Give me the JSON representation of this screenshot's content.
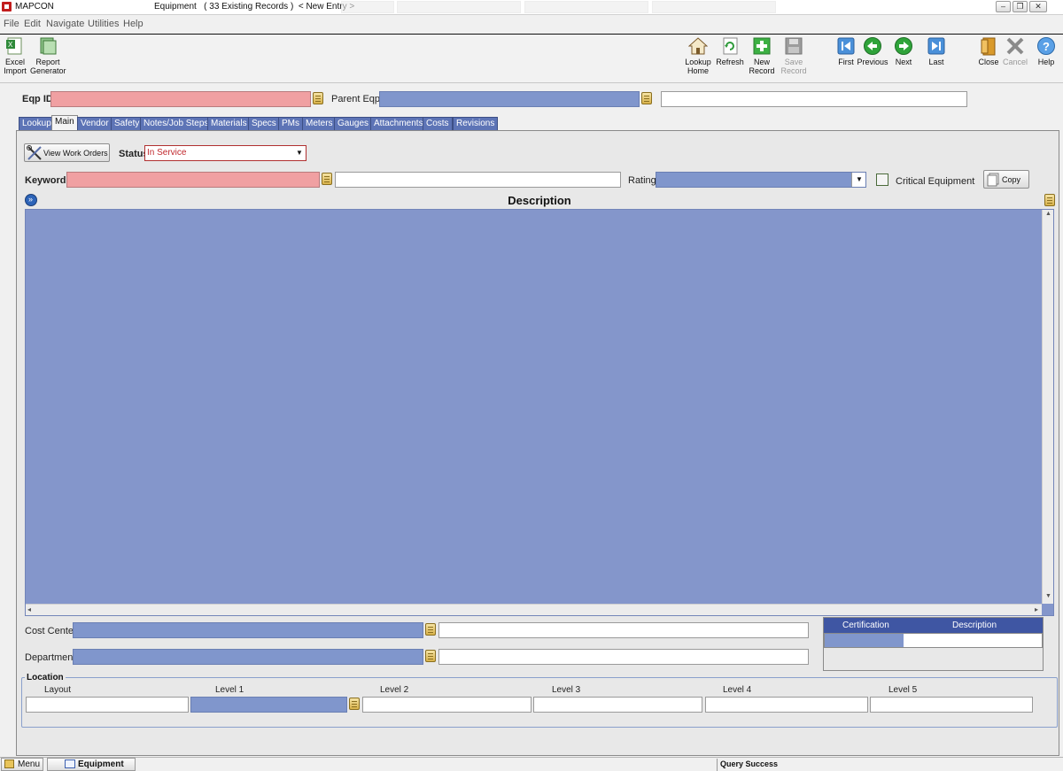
{
  "window": {
    "app_name": "MAPCON",
    "title": "Equipment   ( 33 Existing Records )  < New Entry >"
  },
  "menu": [
    "File",
    "Edit",
    "Navigate",
    "Utilities",
    "Help"
  ],
  "toolbar": {
    "excel_import": [
      "Excel",
      "Import"
    ],
    "report_generator": [
      "Report",
      "Generator"
    ],
    "lookup_home": [
      "Lookup",
      "Home"
    ],
    "refresh": "Refresh",
    "new_record": [
      "New",
      "Record"
    ],
    "save_record": [
      "Save",
      "Record"
    ],
    "first": "First",
    "previous": "Previous",
    "next": "Next",
    "last": "Last",
    "close": "Close",
    "cancel": "Cancel",
    "help": "Help"
  },
  "header": {
    "eqp_id_label": "Eqp ID",
    "eqp_id_value": "",
    "parent_eqp_label": "Parent Eqp",
    "parent_eqp_value": "",
    "parent_eqp_desc": ""
  },
  "tabs": [
    "Lookup",
    "Main",
    "Vendor",
    "Safety",
    "Notes/Job Steps",
    "Materials",
    "Specs",
    "PMs",
    "Meters",
    "Gauges",
    "Attachments",
    "Costs",
    "Revisions"
  ],
  "active_tab": "Main",
  "main": {
    "view_work_orders": "View Work Orders",
    "status_label": "Status",
    "status_value": "In Service",
    "keyword_label": "Keyword",
    "keyword_value": "",
    "keyword_desc": "",
    "rating_label": "Rating",
    "rating_value": "",
    "critical_label": "Critical Equipment",
    "critical_checked": false,
    "copy_label": "Copy",
    "description_header": "Description",
    "description_value": "",
    "cost_center_label": "Cost Center",
    "cost_center_value": "",
    "cost_center_desc": "",
    "department_label": "Department",
    "department_value": "",
    "department_desc": ""
  },
  "certification": {
    "columns": [
      "Certification",
      "Description"
    ],
    "rows": [
      [
        "",
        ""
      ]
    ]
  },
  "location": {
    "caption": "Location",
    "levels": [
      "Layout",
      "Level 1",
      "Level 2",
      "Level 3",
      "Level 4",
      "Level 5"
    ],
    "values": [
      "",
      "",
      "",
      "",
      "",
      ""
    ]
  },
  "statusbar": {
    "menu_tab": "Menu",
    "equipment_tab": "Equipment",
    "message": "Query Success"
  },
  "colors": {
    "required_field": "#f0a0a2",
    "lookup_field": "#8096cc",
    "tab_blue": "#5d74b6",
    "grid_header": "#3f56a3"
  }
}
